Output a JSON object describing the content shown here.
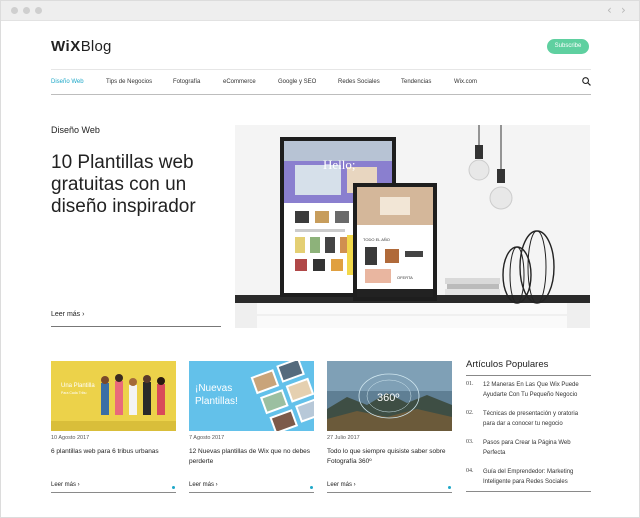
{
  "brand": {
    "logo_bold": "WiX",
    "logo_rest": "Blog",
    "subscribe_label": "Subscribe"
  },
  "nav": {
    "items": [
      {
        "label": "Diseño Web",
        "active": true
      },
      {
        "label": "Tips de Negocios",
        "active": false
      },
      {
        "label": "Fotografía",
        "active": false
      },
      {
        "label": "eCommerce",
        "active": false
      },
      {
        "label": "Google y SEO",
        "active": false
      },
      {
        "label": "Redes Sociales",
        "active": false
      },
      {
        "label": "Tendencias",
        "active": false
      },
      {
        "label": "Wix.com",
        "active": false
      }
    ]
  },
  "hero": {
    "category": "Diseño Web",
    "title": "10 Plantillas web gratuitas con un diseño inspirador",
    "read_more": "Leer más",
    "image_text": {
      "hello": "Hello;",
      "oferta": "OFERTA",
      "todo": "TODO EL AÑO"
    }
  },
  "cards": [
    {
      "date": "10 Agosto 2017",
      "title": "6 plantillas web para 6 tribus urbanas",
      "read_more": "Leer más",
      "thumb_line1": "Una Plantilla",
      "thumb_line2": "Para Cada Tribu"
    },
    {
      "date": "7 Agosto 2017",
      "title": "12 Nuevas plantillas de Wix que no debes perderte",
      "read_more": "Leer más",
      "thumb_line1": "¡Nuevas",
      "thumb_line2": "Plantillas!"
    },
    {
      "date": "27 Julio 2017",
      "title": "Todo lo que siempre quisiste saber sobre Fotografía 360º",
      "read_more": "Leer más",
      "thumb_line1": "360º",
      "thumb_line2": ""
    }
  ],
  "popular": {
    "heading": "Artículos Populares",
    "items": [
      {
        "num": "01.",
        "title": "12 Maneras En Las Que Wix Puede Ayudarte Con Tu Pequeño Negocio"
      },
      {
        "num": "02.",
        "title": "Técnicas de presentación y oratoria para dar a conocer tu negocio"
      },
      {
        "num": "03.",
        "title": "Pasos para Crear la Página Web Perfecta"
      },
      {
        "num": "04.",
        "title": "Guía del Emprendedor: Marketing Inteligente para Redes Sociales"
      }
    ]
  },
  "colors": {
    "accent": "#1fa8c8",
    "subscribe_bg": "#5fd0a0"
  },
  "icons": {
    "search": "search-icon",
    "back": "chevron-left-icon",
    "forward": "chevron-right-icon"
  }
}
